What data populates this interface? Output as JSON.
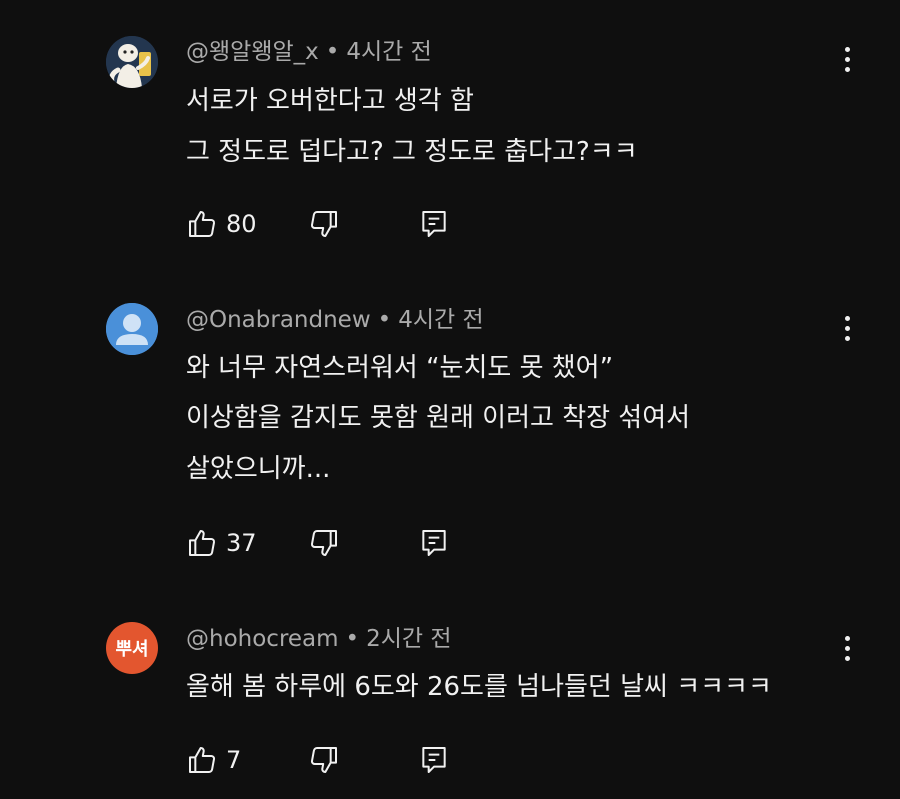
{
  "comments": [
    {
      "author": "@왱알왱알_x",
      "separator": "•",
      "time": "4시간 전",
      "lines": [
        "서로가 오버한다고 생각 함",
        "그 정도로 덥다고? 그 정도로 춥다고?ㅋㅋ"
      ],
      "likes": "80",
      "avatar": {
        "type": "cartoon",
        "bg": "#23364f"
      }
    },
    {
      "author": "@Onabrandnew",
      "separator": "•",
      "time": "4시간 전",
      "lines": [
        "와 너무 자연스러워서 “눈치도 못 챘어”",
        "이상함을 감지도 못함 원래 이러고 착장 섞여서",
        "살았으니까..."
      ],
      "likes": "37",
      "avatar": {
        "type": "default-person",
        "bg": "#4a90d9"
      }
    },
    {
      "author": "@hohocream",
      "separator": "•",
      "time": "2시간 전",
      "lines": [
        "올해 봄  하루에 6도와 26도를 넘나들던 날씨 ㅋㅋㅋㅋ"
      ],
      "likes": "7",
      "avatar": {
        "type": "text",
        "text": "뿌셔",
        "bg": "#e3562f"
      }
    }
  ],
  "icons": {
    "like": "thumbs-up-icon",
    "dislike": "thumbs-down-icon",
    "reply": "reply-icon",
    "more": "more-vertical-icon"
  }
}
